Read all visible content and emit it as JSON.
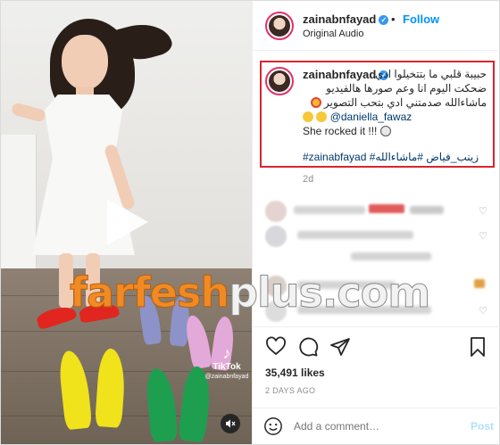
{
  "header": {
    "username": "zainabnfayad",
    "separator": "•",
    "follow_label": "Follow",
    "audio_label": "Original Audio"
  },
  "caption": {
    "username": "zainabnfayad",
    "arabic_line1": "حبيبة قلبي ما بتتخيلوا ادي",
    "arabic_line2": "ضحكت اليوم انا وعم صورها هالفيديو",
    "arabic_line3": "ماشاءالله صدمتني ادي بتحب التصوير",
    "mention": "@daniella_fawaz",
    "english_line": "She rocked it !!!",
    "hashtags": "#zainabfayad #زينب_فياض #ماشاءالله"
  },
  "time_ago": "2d",
  "video": {
    "watermark_part1": "farfesh",
    "watermark_part2": "plus.com",
    "tiktok_logo": "♪",
    "tiktok_name": "TikTok",
    "tiktok_handle": "@zainabnfayad",
    "mute_icon": "🔇"
  },
  "likes": "35,491 likes",
  "date": "2 DAYS AGO",
  "add_comment": {
    "placeholder": "Add a comment…",
    "post_label": "Post"
  },
  "colors": {
    "follow_blue": "#0095f6",
    "highlight_border": "#d9252f",
    "watermark_orange": "#f08a24",
    "verified_blue": "#3897f0"
  }
}
